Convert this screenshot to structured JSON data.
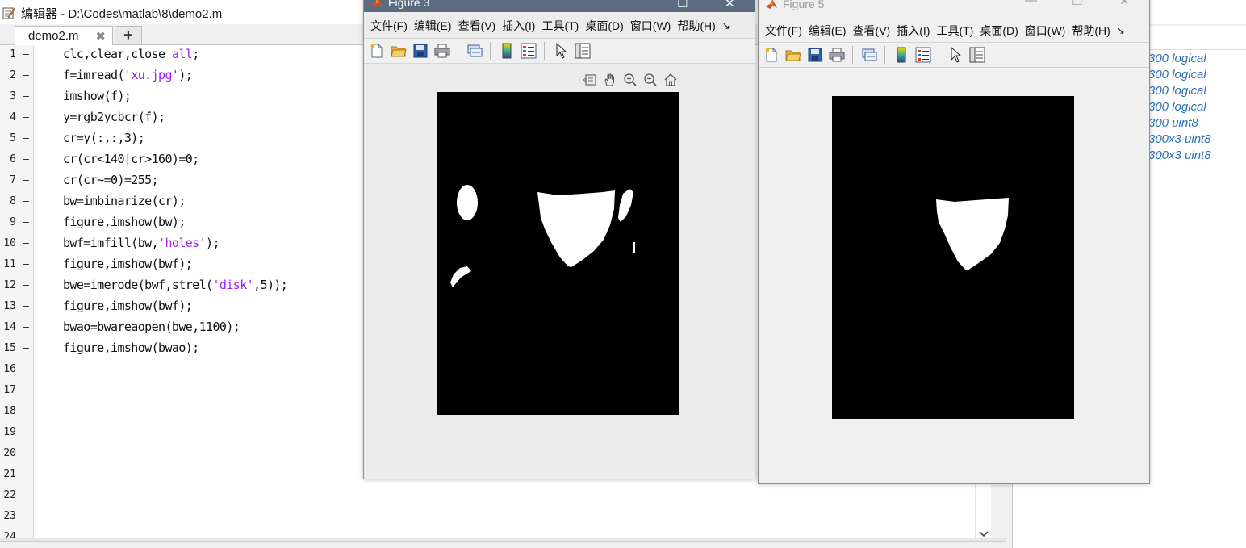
{
  "editor": {
    "title": "编辑器 - D:\\Codes\\matlab\\8\\demo2.m",
    "tab_label": "demo2.m",
    "tab_close": "✖",
    "tab_add": "+",
    "line_numbers": [
      "1",
      "2",
      "3",
      "4",
      "5",
      "6",
      "7",
      "8",
      "9",
      "10",
      "11",
      "12",
      "13",
      "14",
      "15",
      "16",
      "17",
      "18",
      "19",
      "20",
      "21",
      "22",
      "23",
      "24"
    ],
    "code_lines": [
      {
        "pre": "clc,clear,close ",
        "str": "all",
        "post": ";"
      },
      {
        "pre": "f=imread(",
        "str": "'xu.jpg'",
        "post": ");"
      },
      {
        "pre": "imshow(f);",
        "str": "",
        "post": ""
      },
      {
        "pre": "y=rgb2ycbcr(f);",
        "str": "",
        "post": ""
      },
      {
        "pre": "cr=y(:,:,3);",
        "str": "",
        "post": ""
      },
      {
        "pre": "cr(cr<140|cr>160)=0;",
        "str": "",
        "post": ""
      },
      {
        "pre": "cr(cr~=0)=255;",
        "str": "",
        "post": ""
      },
      {
        "pre": "bw=imbinarize(cr);",
        "str": "",
        "post": ""
      },
      {
        "pre": "figure,imshow(bw);",
        "str": "",
        "post": ""
      },
      {
        "pre": "bwf=imfill(bw,",
        "str": "'holes'",
        "post": ");"
      },
      {
        "pre": "figure,imshow(bwf);",
        "str": "",
        "post": ""
      },
      {
        "pre": "bwe=imerode(bwf,strel(",
        "str": "'disk'",
        "post": ",5));"
      },
      {
        "pre": "figure,imshow(bwf);",
        "str": "",
        "post": ""
      },
      {
        "pre": "bwao=bwareaopen(bwe,1100);",
        "str": "",
        "post": ""
      },
      {
        "pre": "figure,imshow(bwao);",
        "str": "",
        "post": ""
      }
    ],
    "scroll_down_icon": "chevron-down-icon"
  },
  "workspace": {
    "values": [
      "300 logical",
      "300 logical",
      "300 logical",
      "300 logical",
      "300 uint8",
      "300x3 uint8",
      "300x3 uint8"
    ]
  },
  "figure3": {
    "title": "Figure 3",
    "menu": [
      "文件(F)",
      "编辑(E)",
      "查看(V)",
      "插入(I)",
      "工具(T)",
      "桌面(D)",
      "窗口(W)",
      "帮助(H)"
    ],
    "more": "↘"
  },
  "figure5": {
    "title": "Figure 5",
    "menu": [
      "文件(F)",
      "编辑(E)",
      "查看(V)",
      "插入(I)",
      "工具(T)",
      "桌面(D)",
      "窗口(W)",
      "帮助(H)"
    ],
    "more": "↘"
  },
  "colors": {
    "string_purple": "#a020f0",
    "workspace_blue": "#2a6fb6",
    "image_bg": "#000000",
    "mask_fg": "#ffffff"
  }
}
